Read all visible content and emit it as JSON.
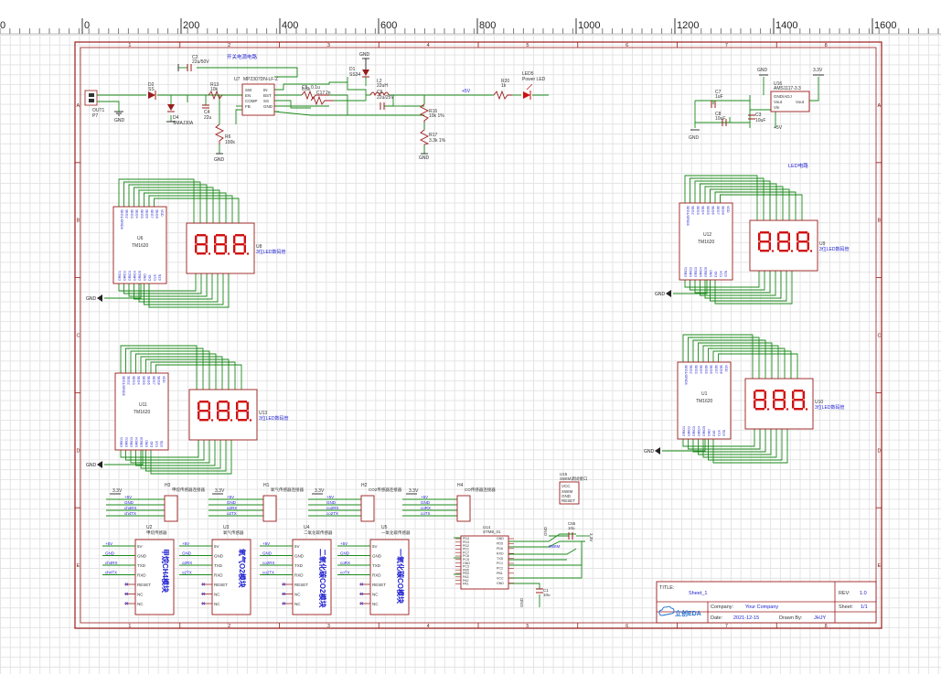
{
  "ruler": {
    "ticks": [
      "0",
      "0",
      "200",
      "400",
      "600",
      "800",
      "1000",
      "1200",
      "1400",
      "1600"
    ]
  },
  "sheet": {
    "title_label": "TITLE:",
    "title": "Sheet_1",
    "rev_label": "REV:",
    "rev": "1.0",
    "company_label": "Company:",
    "company": "Your Company",
    "sheet_label": "Sheet:",
    "sheet_no": "1/1",
    "date_label": "Date:",
    "date": "2021-12-15",
    "drawn_label": "Drawn By:",
    "drawn": "JHJY",
    "logo": "立创EDA"
  },
  "zone_rows": [
    "A",
    "B",
    "C",
    "D",
    "E"
  ],
  "zone_cols": [
    "1",
    "2",
    "3",
    "4",
    "5",
    "6",
    "7",
    "8"
  ],
  "power": {
    "title": "开关电源电路",
    "out_label": "OUT1",
    "p7": "P7",
    "gnd": "GND",
    "d2": "D2",
    "d2_val": "SS",
    "d4": "D4",
    "d4_val": "SMAJ30A",
    "r13": "R13",
    "r13_val": "10k",
    "c4": "C4",
    "c4_val": "22u",
    "r6": "R6",
    "r6_val": "100k",
    "c2": "C2",
    "c2_val": "22u/50V",
    "u7": "U7",
    "u7_val": "MP2307DN-LF-Z",
    "pins_left": [
      "SW",
      "EN",
      "COMP",
      "FB"
    ],
    "pins_right": [
      "IN",
      "BST",
      "SS",
      "GND"
    ],
    "c5": "C5",
    "c5_val": "0.1u",
    "r12_val": "6.8k",
    "c17": "C17",
    "c17_val": "2n",
    "d1": "D1",
    "d1_val": "SS34",
    "l2": "L2",
    "l2_val": "22uH",
    "c6": "C6",
    "c6_val": "22u/25V",
    "r16": "R16",
    "r16_val": "10k 1%",
    "r17": "R17",
    "r17_val": "3.3k 1%",
    "net_5v": "+5V",
    "r20": "R20",
    "r20_val": "1k",
    "led": "LED5",
    "led_val": "Power LED"
  },
  "ldo": {
    "c7": "C7",
    "c7_val": "1uF",
    "c8": "C8",
    "c8_val": "10uF",
    "c3": "C3",
    "c3_val": "10uF",
    "u_ref": "U16",
    "u_val": "AMS1117-3.3",
    "pin_gnd": "GND/ADJ",
    "pin_vout": "Vout",
    "pin_out": "Vout",
    "pin_vin": "Vin",
    "v33": "3.3V",
    "v5": "+5V",
    "gnd": "GND"
  },
  "led_section_label": "LED电路",
  "tm1620": [
    {
      "ref": "U6",
      "val": "TM1620",
      "disp_ref": "U8",
      "disp_val": "3位LED数码管"
    },
    {
      "ref": "U11",
      "val": "TM1620",
      "disp_ref": "U13",
      "disp_val": "3位LED数码管"
    },
    {
      "ref": "U12",
      "val": "TM1620",
      "disp_ref": "U9",
      "disp_val": "3位LED数码管"
    },
    {
      "ref": "U1",
      "val": "TM1620",
      "disp_ref": "U10",
      "disp_val": "3位LED数码管"
    }
  ],
  "ic_pins_top": [
    "SEG1/GRID6",
    "SEG2",
    "SEG3",
    "SEG4",
    "SEG5",
    "SEG6",
    "SEG7",
    "SEG8",
    "VDD"
  ],
  "ic_pins_bottom": [
    "GRID1",
    "GRID2",
    "GRID3",
    "GRID4",
    "GRID5",
    "GND",
    "DIO",
    "CLK",
    "STB"
  ],
  "headers": [
    {
      "ref": "H3",
      "val": "甲烷传感器连接器",
      "v": "3.3V",
      "pins": [
        "+5V",
        "GND",
        "ch4RX",
        "ch4TX"
      ]
    },
    {
      "ref": "H1",
      "val": "氧气传感器连接器",
      "v": "3.3V",
      "pins": [
        "+5V",
        "GND",
        "o2RX",
        "o2TX"
      ]
    },
    {
      "ref": "H2",
      "val": "CO2传感器连接器",
      "v": "3.3V",
      "pins": [
        "+5V",
        "GND",
        "co2RX",
        "co2TX"
      ]
    },
    {
      "ref": "H4",
      "val": "CO传感器连接器",
      "v": "3.3V",
      "pins": [
        "+5V",
        "GND",
        "coRX",
        "coTX"
      ]
    }
  ],
  "sw_module": {
    "ref": "U15",
    "val": "SWIM调试接口",
    "pins": [
      "VCC",
      "SWIM",
      "GND",
      "RESET"
    ]
  },
  "sensors": [
    {
      "ref": "U2",
      "title": "甲烷传感器",
      "name": "甲烷CH4模块",
      "nets": [
        "+5V",
        "GND",
        "ch4RX",
        "ch4TX",
        "",
        ""
      ]
    },
    {
      "ref": "U3",
      "title": "氧气传感器",
      "name": "氧气O2模块",
      "nets": [
        "+5V",
        "GND",
        "o2RX",
        "o2TX",
        "",
        ""
      ]
    },
    {
      "ref": "U4",
      "title": "二氧化碳传感器",
      "name": "二氧化碳CO2模块",
      "nets": [
        "+5V",
        "GND",
        "co2RX",
        "co2TX",
        "",
        ""
      ]
    },
    {
      "ref": "U5",
      "title": "一氧化碳传感器",
      "name": "一氧化碳CO模块",
      "nets": [
        "+5V",
        "GND",
        "coRX",
        "coTX",
        "",
        ""
      ]
    }
  ],
  "sensor_pins": [
    "5V",
    "GND",
    "TXD",
    "RXD",
    "RESET",
    "NC",
    "NC"
  ],
  "mcu": {
    "ref": "U14",
    "val": "STM8_01",
    "pins_left": [
      "PD4",
      "PD3",
      "PD2",
      "PD1",
      "PC7",
      "PC6",
      "PC5",
      "GND",
      "PC3",
      "PB5",
      "PB4",
      "PA3",
      "PA2",
      "PA1"
    ],
    "pins_right": [
      "GND",
      "PD5",
      "PD6",
      "RXD",
      "TXD",
      "PC1",
      "PC2",
      "PB1",
      "VCC",
      "GND"
    ],
    "c1": "C1",
    "c1_val": "10u",
    "c55": "C55",
    "c55_val": "10u",
    "net_swim": "SWIM",
    "net_v": "3.3V",
    "gnd": "GND"
  }
}
